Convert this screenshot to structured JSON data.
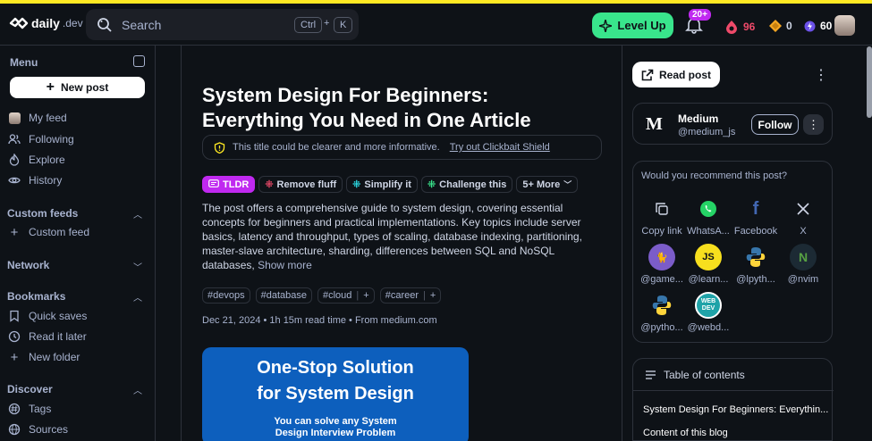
{
  "header": {
    "logo_text": "daily",
    "logo_suffix": ".dev",
    "search_placeholder": "Search",
    "shortcut_ctrl": "Ctrl",
    "shortcut_plus": "+",
    "shortcut_key": "K",
    "level_up_label": "Level Up",
    "notifications_badge": "20+",
    "reputation": "96",
    "points": "0",
    "streak": "60"
  },
  "sidebar": {
    "menu_label": "Menu",
    "new_post_label": "New post",
    "primary_items": [
      {
        "label": "My feed",
        "icon": "avatar-icon"
      },
      {
        "label": "Following",
        "icon": "users-icon"
      },
      {
        "label": "Explore",
        "icon": "flame-icon"
      },
      {
        "label": "History",
        "icon": "eye-icon"
      }
    ],
    "custom_feeds_label": "Custom feeds",
    "custom_feed_item": "Custom feed",
    "network_label": "Network",
    "bookmarks_label": "Bookmarks",
    "bookmark_items": [
      {
        "label": "Quick saves",
        "icon": "bookmark-icon"
      },
      {
        "label": "Read it later",
        "icon": "clock-icon"
      },
      {
        "label": "New folder",
        "icon": "plus-icon"
      }
    ],
    "discover_label": "Discover",
    "discover_items": [
      {
        "label": "Tags",
        "icon": "hash-icon"
      },
      {
        "label": "Sources",
        "icon": "globe-icon"
      }
    ]
  },
  "post": {
    "title": "System Design For Beginners: Everything You Need in One Article",
    "clarity_note": "This title could be clearer and more informative.",
    "clarity_link": "Try out Clickbait Shield",
    "actions": [
      "TLDR",
      "Remove fluff",
      "Simplify it",
      "Challenge this",
      "5+ More"
    ],
    "summary": "The post offers a comprehensive guide to system design, covering essential concepts for beginners and practical implementations. Key topics include server basics, latency and throughput, types of scaling, database indexing, partitioning, master-slave architecture, sharding, differences between SQL and NoSQL databases,",
    "show_more": "Show more",
    "tags": [
      "#devops",
      "#database",
      "#cloud",
      "#career"
    ],
    "meta": "Dec 21, 2024 • 1h 15m read time • From medium.com",
    "cover_heading_1": "One-Stop Solution",
    "cover_heading_2": "for System Design",
    "cover_sub_1": "You can solve any System",
    "cover_sub_2": "Design Interview Problem"
  },
  "right": {
    "read_post_label": "Read post",
    "source_logo": "M",
    "source_name": "Medium",
    "source_handle": "@medium_js",
    "follow_label": "Follow",
    "recommend_question": "Would you recommend this post?",
    "share_row1": [
      "Copy link",
      "WhatsA...",
      "Facebook",
      "X"
    ],
    "share_row2": [
      "@game...",
      "@learn...",
      "@lpyth...",
      "@nvim"
    ],
    "share_row3": [
      "@pytho...",
      "@webd..."
    ],
    "toc_label": "Table of contents",
    "toc_items": [
      "System Design For Beginners: Everythin...",
      "Content of this blog"
    ]
  },
  "colors": {
    "accent_green": "#39e58c",
    "tldr_purple": "#c029f0",
    "top_stripe": "#ffe923",
    "cover_blue": "#0d5fbd"
  }
}
